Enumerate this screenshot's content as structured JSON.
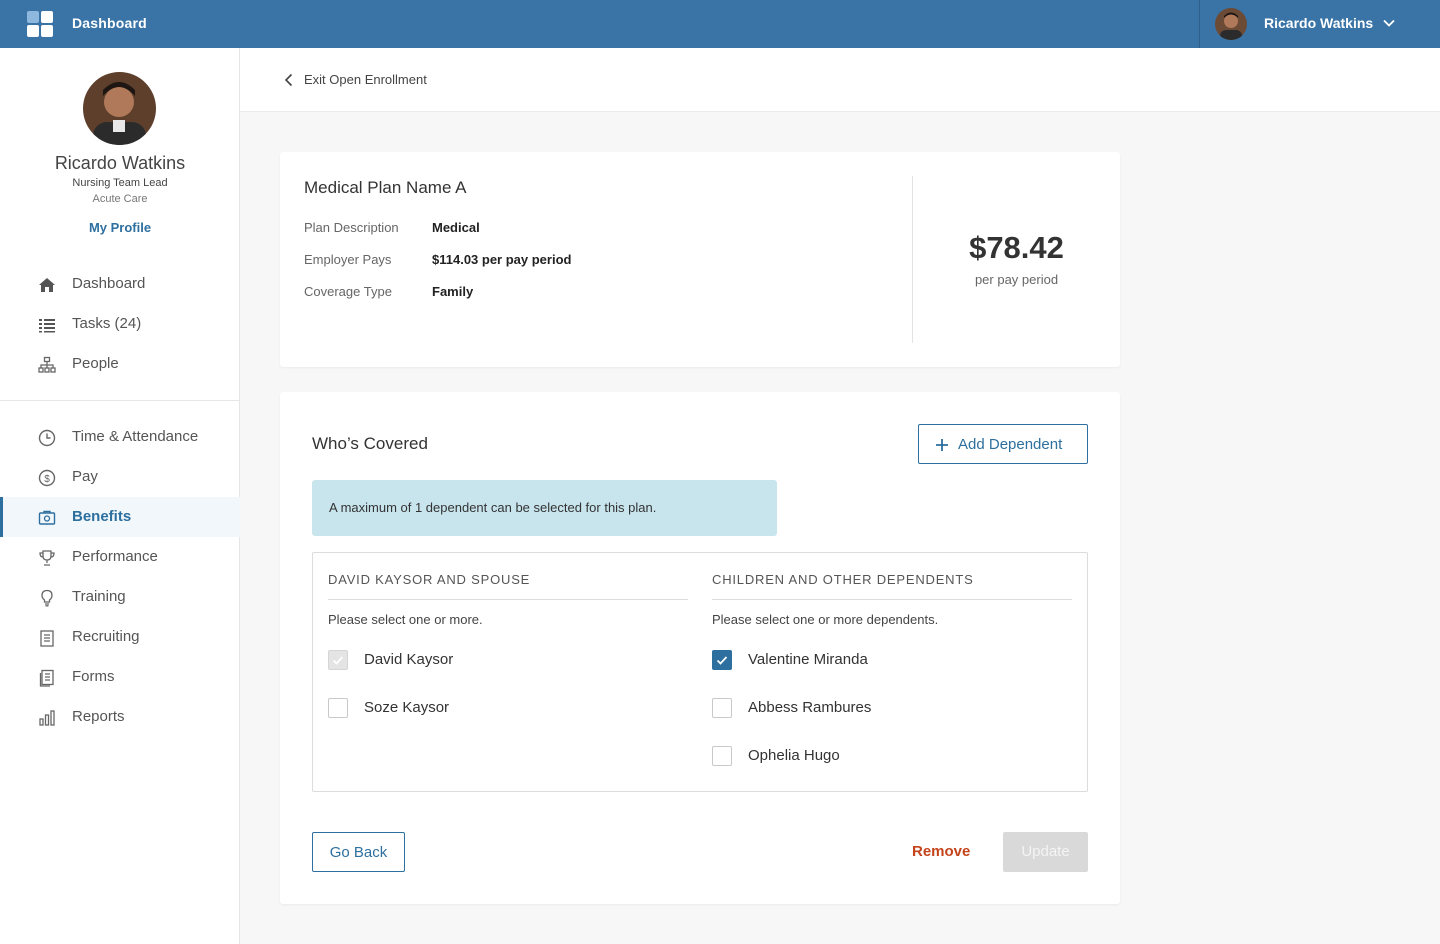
{
  "topbar": {
    "title": "Dashboard",
    "user_name": "Ricardo Watkins",
    "brand_color": "#3a74a6"
  },
  "profile": {
    "name": "Ricardo Watkins",
    "role": "Nursing Team Lead",
    "department": "Acute Care",
    "link": "My Profile"
  },
  "nav_primary": [
    {
      "label": "Dashboard",
      "icon": "home-icon"
    },
    {
      "label": "Tasks (24)",
      "icon": "list-icon"
    },
    {
      "label": "People",
      "icon": "org-chart-icon"
    }
  ],
  "nav_secondary": [
    {
      "label": "Time & Attendance",
      "icon": "clock-icon"
    },
    {
      "label": "Pay",
      "icon": "dollar-icon"
    },
    {
      "label": "Benefits",
      "icon": "benefits-icon",
      "active": true
    },
    {
      "label": "Performance",
      "icon": "trophy-icon"
    },
    {
      "label": "Training",
      "icon": "lightbulb-icon"
    },
    {
      "label": "Recruiting",
      "icon": "clipboard-icon"
    },
    {
      "label": "Forms",
      "icon": "forms-icon"
    },
    {
      "label": "Reports",
      "icon": "bar-chart-icon"
    }
  ],
  "header": {
    "back_label": "Exit Open Enrollment"
  },
  "plan": {
    "title": "Medical Plan Name A",
    "rows": [
      {
        "key": "Plan Description",
        "value": "Medical"
      },
      {
        "key": "Employer Pays",
        "value": "$114.03 per pay period"
      },
      {
        "key": "Coverage Type",
        "value": "Family"
      }
    ],
    "price": "$78.42",
    "price_period": "per pay period"
  },
  "covered": {
    "title": "Who’s Covered",
    "add_button": "Add Dependent",
    "notice": "A maximum of 1 dependent can be selected for this plan.",
    "left": {
      "heading": "DAVID KAYSOR AND SPOUSE",
      "hint": "Please select one or more.",
      "people": [
        {
          "name": "David Kaysor",
          "state": "disabled-checked"
        },
        {
          "name": "Soze Kaysor",
          "state": "unchecked"
        }
      ]
    },
    "right": {
      "heading": "CHILDREN AND OTHER DEPENDENTS",
      "hint": "Please select one or more dependents.",
      "people": [
        {
          "name": "Valentine Miranda",
          "state": "checked"
        },
        {
          "name": "Abbess Rambures",
          "state": "unchecked"
        },
        {
          "name": "Ophelia Hugo",
          "state": "unchecked"
        }
      ]
    },
    "go_back": "Go Back",
    "remove": "Remove",
    "update": "Update",
    "accent_color": "#2d6f9e",
    "danger_color": "#c4441c"
  }
}
